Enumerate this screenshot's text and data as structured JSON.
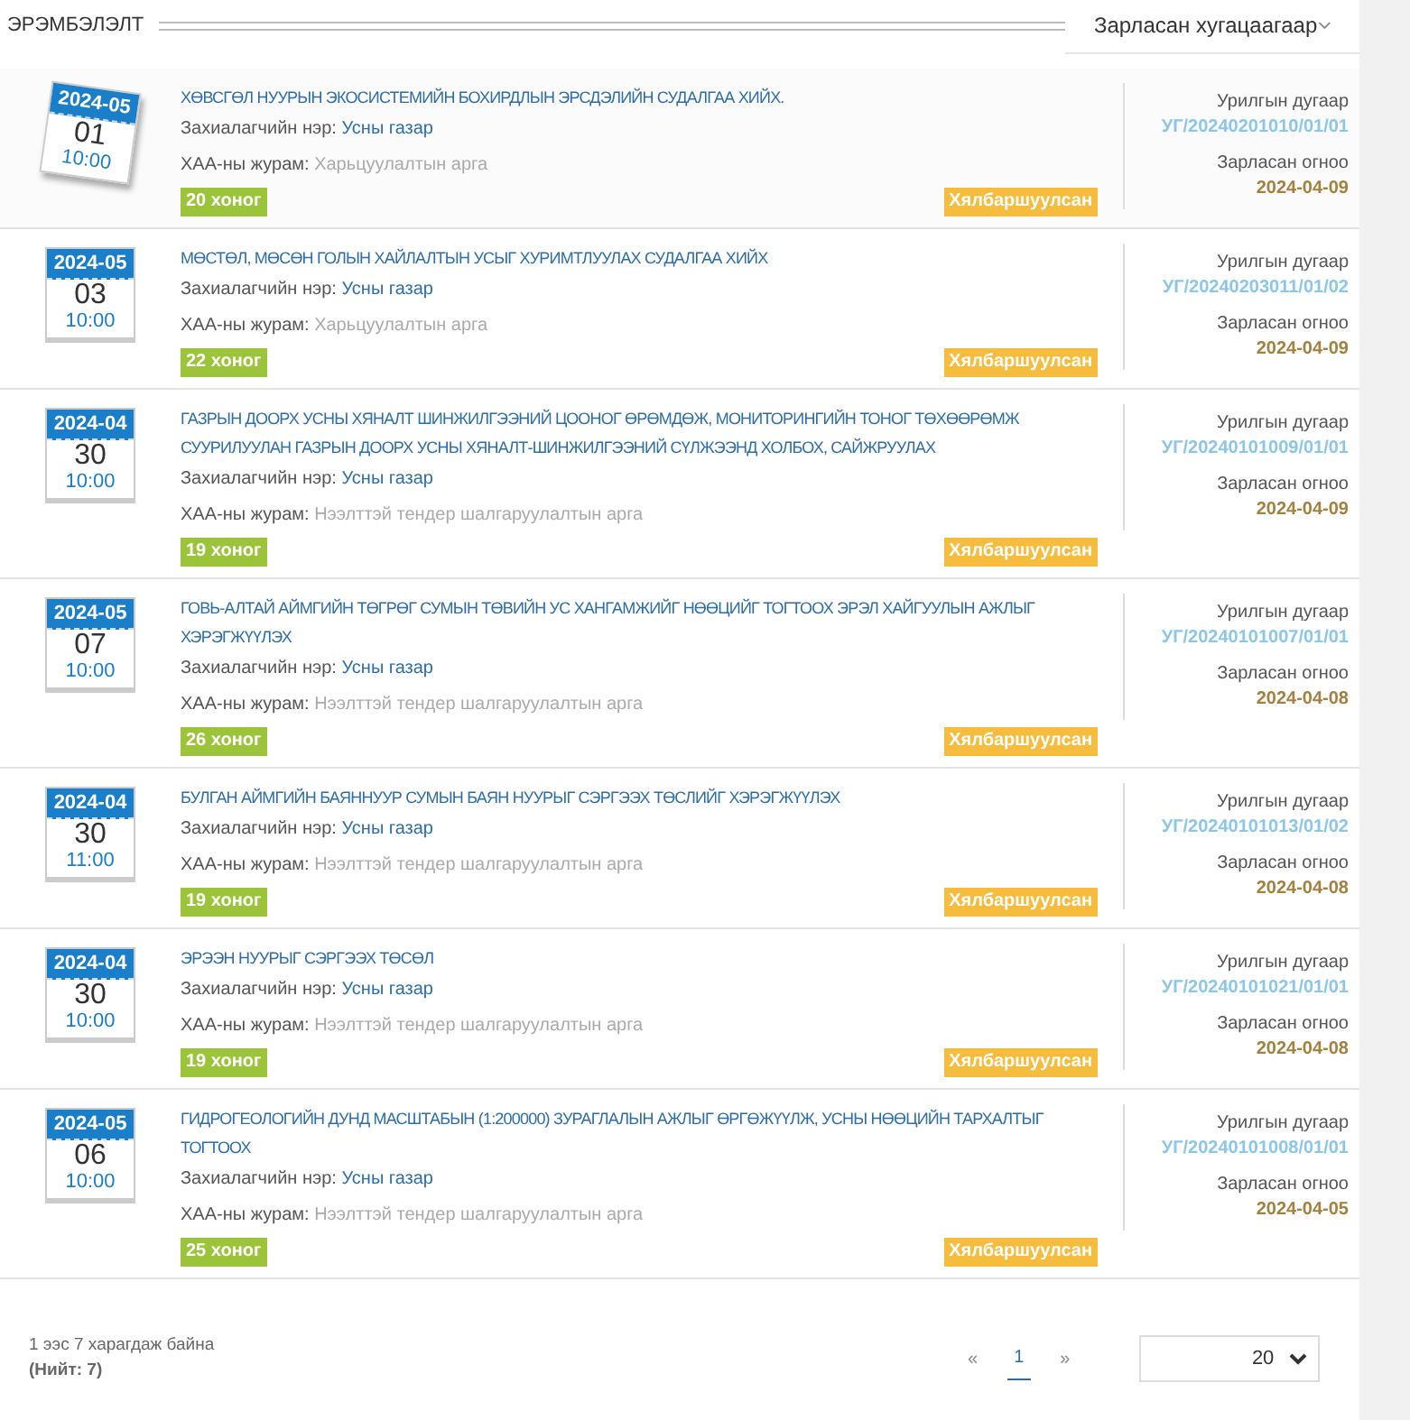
{
  "header": {
    "title": "ЭРЭМБЭЛЭЛТ",
    "sort_select": "Зарласан хугацаагаар"
  },
  "tenders": [
    {
      "month": "2024-05",
      "day": "01",
      "time": "10:00",
      "hovered": true,
      "title": "ХӨВСГӨЛ НУУРЫН ЭКОСИСТЕМИЙН БОХИРДЛЫН ЭРСДЭЛИЙН СУДАЛГАА ХИЙХ.",
      "customer_label": "Захиалагчийн нэр:",
      "customer": "Усны газар",
      "method_label": "ХАА-ны журам:",
      "method": "Харьцуулалтын арга",
      "days": "20 хоног",
      "type_badge": "Хялбаршуулсан",
      "number_label": "Урилгын дугаар",
      "number": "УГ/20240201010/01/01",
      "date_label": "Зарласан огноо",
      "date": "2024-04-09"
    },
    {
      "month": "2024-05",
      "day": "03",
      "time": "10:00",
      "hovered": false,
      "title": "МӨСТӨЛ, МӨСӨН ГОЛЫН ХАЙЛАЛТЫН УСЫГ ХУРИМТЛУУЛАХ СУДАЛГАА ХИЙХ",
      "customer_label": "Захиалагчийн нэр:",
      "customer": "Усны газар",
      "method_label": "ХАА-ны журам:",
      "method": "Харьцуулалтын арга",
      "days": "22 хоног",
      "type_badge": "Хялбаршуулсан",
      "number_label": "Урилгын дугаар",
      "number": "УГ/20240203011/01/02",
      "date_label": "Зарласан огноо",
      "date": "2024-04-09"
    },
    {
      "month": "2024-04",
      "day": "30",
      "time": "10:00",
      "hovered": false,
      "title": "ГАЗРЫН ДООРХ УСНЫ ХЯНАЛТ ШИНЖИЛГЭЭНИЙ ЦООНОГ ӨРӨМДӨЖ, МОНИТОРИНГИЙН ТОНОГ ТӨХӨӨРӨМЖ СУУРИЛУУЛАН ГАЗРЫН ДООРХ УСНЫ ХЯНАЛТ-ШИНЖИЛГЭЭНИЙ СҮЛЖЭЭНД ХОЛБОХ, САЙЖРУУЛАХ",
      "customer_label": "Захиалагчийн нэр:",
      "customer": "Усны газар",
      "method_label": "ХАА-ны журам:",
      "method": "Нээлттэй тендер шалгаруулалтын арга",
      "days": "19 хоног",
      "type_badge": "Хялбаршуулсан",
      "number_label": "Урилгын дугаар",
      "number": "УГ/20240101009/01/01",
      "date_label": "Зарласан огноо",
      "date": "2024-04-09"
    },
    {
      "month": "2024-05",
      "day": "07",
      "time": "10:00",
      "hovered": false,
      "title": "ГОВЬ-АЛТАЙ АЙМГИЙН ТӨГРӨГ СУМЫН ТӨВИЙН УС ХАНГАМЖИЙГ НӨӨЦИЙГ ТОГТООХ ЭРЭЛ ХАЙГУУЛЫН АЖЛЫГ ХЭРЭГЖҮҮЛЭХ",
      "customer_label": "Захиалагчийн нэр:",
      "customer": "Усны газар",
      "method_label": "ХАА-ны журам:",
      "method": "Нээлттэй тендер шалгаруулалтын арга",
      "days": "26 хоног",
      "type_badge": "Хялбаршуулсан",
      "number_label": "Урилгын дугаар",
      "number": "УГ/20240101007/01/01",
      "date_label": "Зарласан огноо",
      "date": "2024-04-08"
    },
    {
      "month": "2024-04",
      "day": "30",
      "time": "11:00",
      "hovered": false,
      "title": "БУЛГАН АЙМГИЙН БАЯННУУР СУМЫН БАЯН НУУРЫГ СЭРГЭЭХ ТӨСЛИЙГ ХЭРЭГЖҮҮЛЭХ",
      "customer_label": "Захиалагчийн нэр:",
      "customer": "Усны газар",
      "method_label": "ХАА-ны журам:",
      "method": "Нээлттэй тендер шалгаруулалтын арга",
      "days": "19 хоног",
      "type_badge": "Хялбаршуулсан",
      "number_label": "Урилгын дугаар",
      "number": "УГ/20240101013/01/02",
      "date_label": "Зарласан огноо",
      "date": "2024-04-08"
    },
    {
      "month": "2024-04",
      "day": "30",
      "time": "10:00",
      "hovered": false,
      "title": "ЭРЭЭН НУУРЫГ СЭРГЭЭХ ТӨСӨЛ",
      "customer_label": "Захиалагчийн нэр:",
      "customer": "Усны газар",
      "method_label": "ХАА-ны журам:",
      "method": "Нээлттэй тендер шалгаруулалтын арга",
      "days": "19 хоног",
      "type_badge": "Хялбаршуулсан",
      "number_label": "Урилгын дугаар",
      "number": "УГ/20240101021/01/01",
      "date_label": "Зарласан огноо",
      "date": "2024-04-08"
    },
    {
      "month": "2024-05",
      "day": "06",
      "time": "10:00",
      "hovered": false,
      "title": "ГИДРОГЕОЛОГИЙН ДУНД МАСШТАБЫН (1:200000) ЗУРАГЛАЛЫН АЖЛЫГ ӨРГӨЖҮҮЛЖ, УСНЫ НӨӨЦИЙН ТАРХАЛТЫГ ТОГТООХ",
      "customer_label": "Захиалагчийн нэр:",
      "customer": "Усны газар",
      "method_label": "ХАА-ны журам:",
      "method": "Нээлттэй тендер шалгаруулалтын арга",
      "days": "25 хоног",
      "type_badge": "Хялбаршуулсан",
      "number_label": "Урилгын дугаар",
      "number": "УГ/20240101008/01/01",
      "date_label": "Зарласан огноо",
      "date": "2024-04-05"
    }
  ],
  "footer": {
    "summary": "1 ээс 7 харагдаж байна",
    "total": "(Нийт: 7)",
    "prev": "«",
    "pages": [
      {
        "label": "1",
        "selected": true
      }
    ],
    "next": "»",
    "page_size": "20"
  }
}
